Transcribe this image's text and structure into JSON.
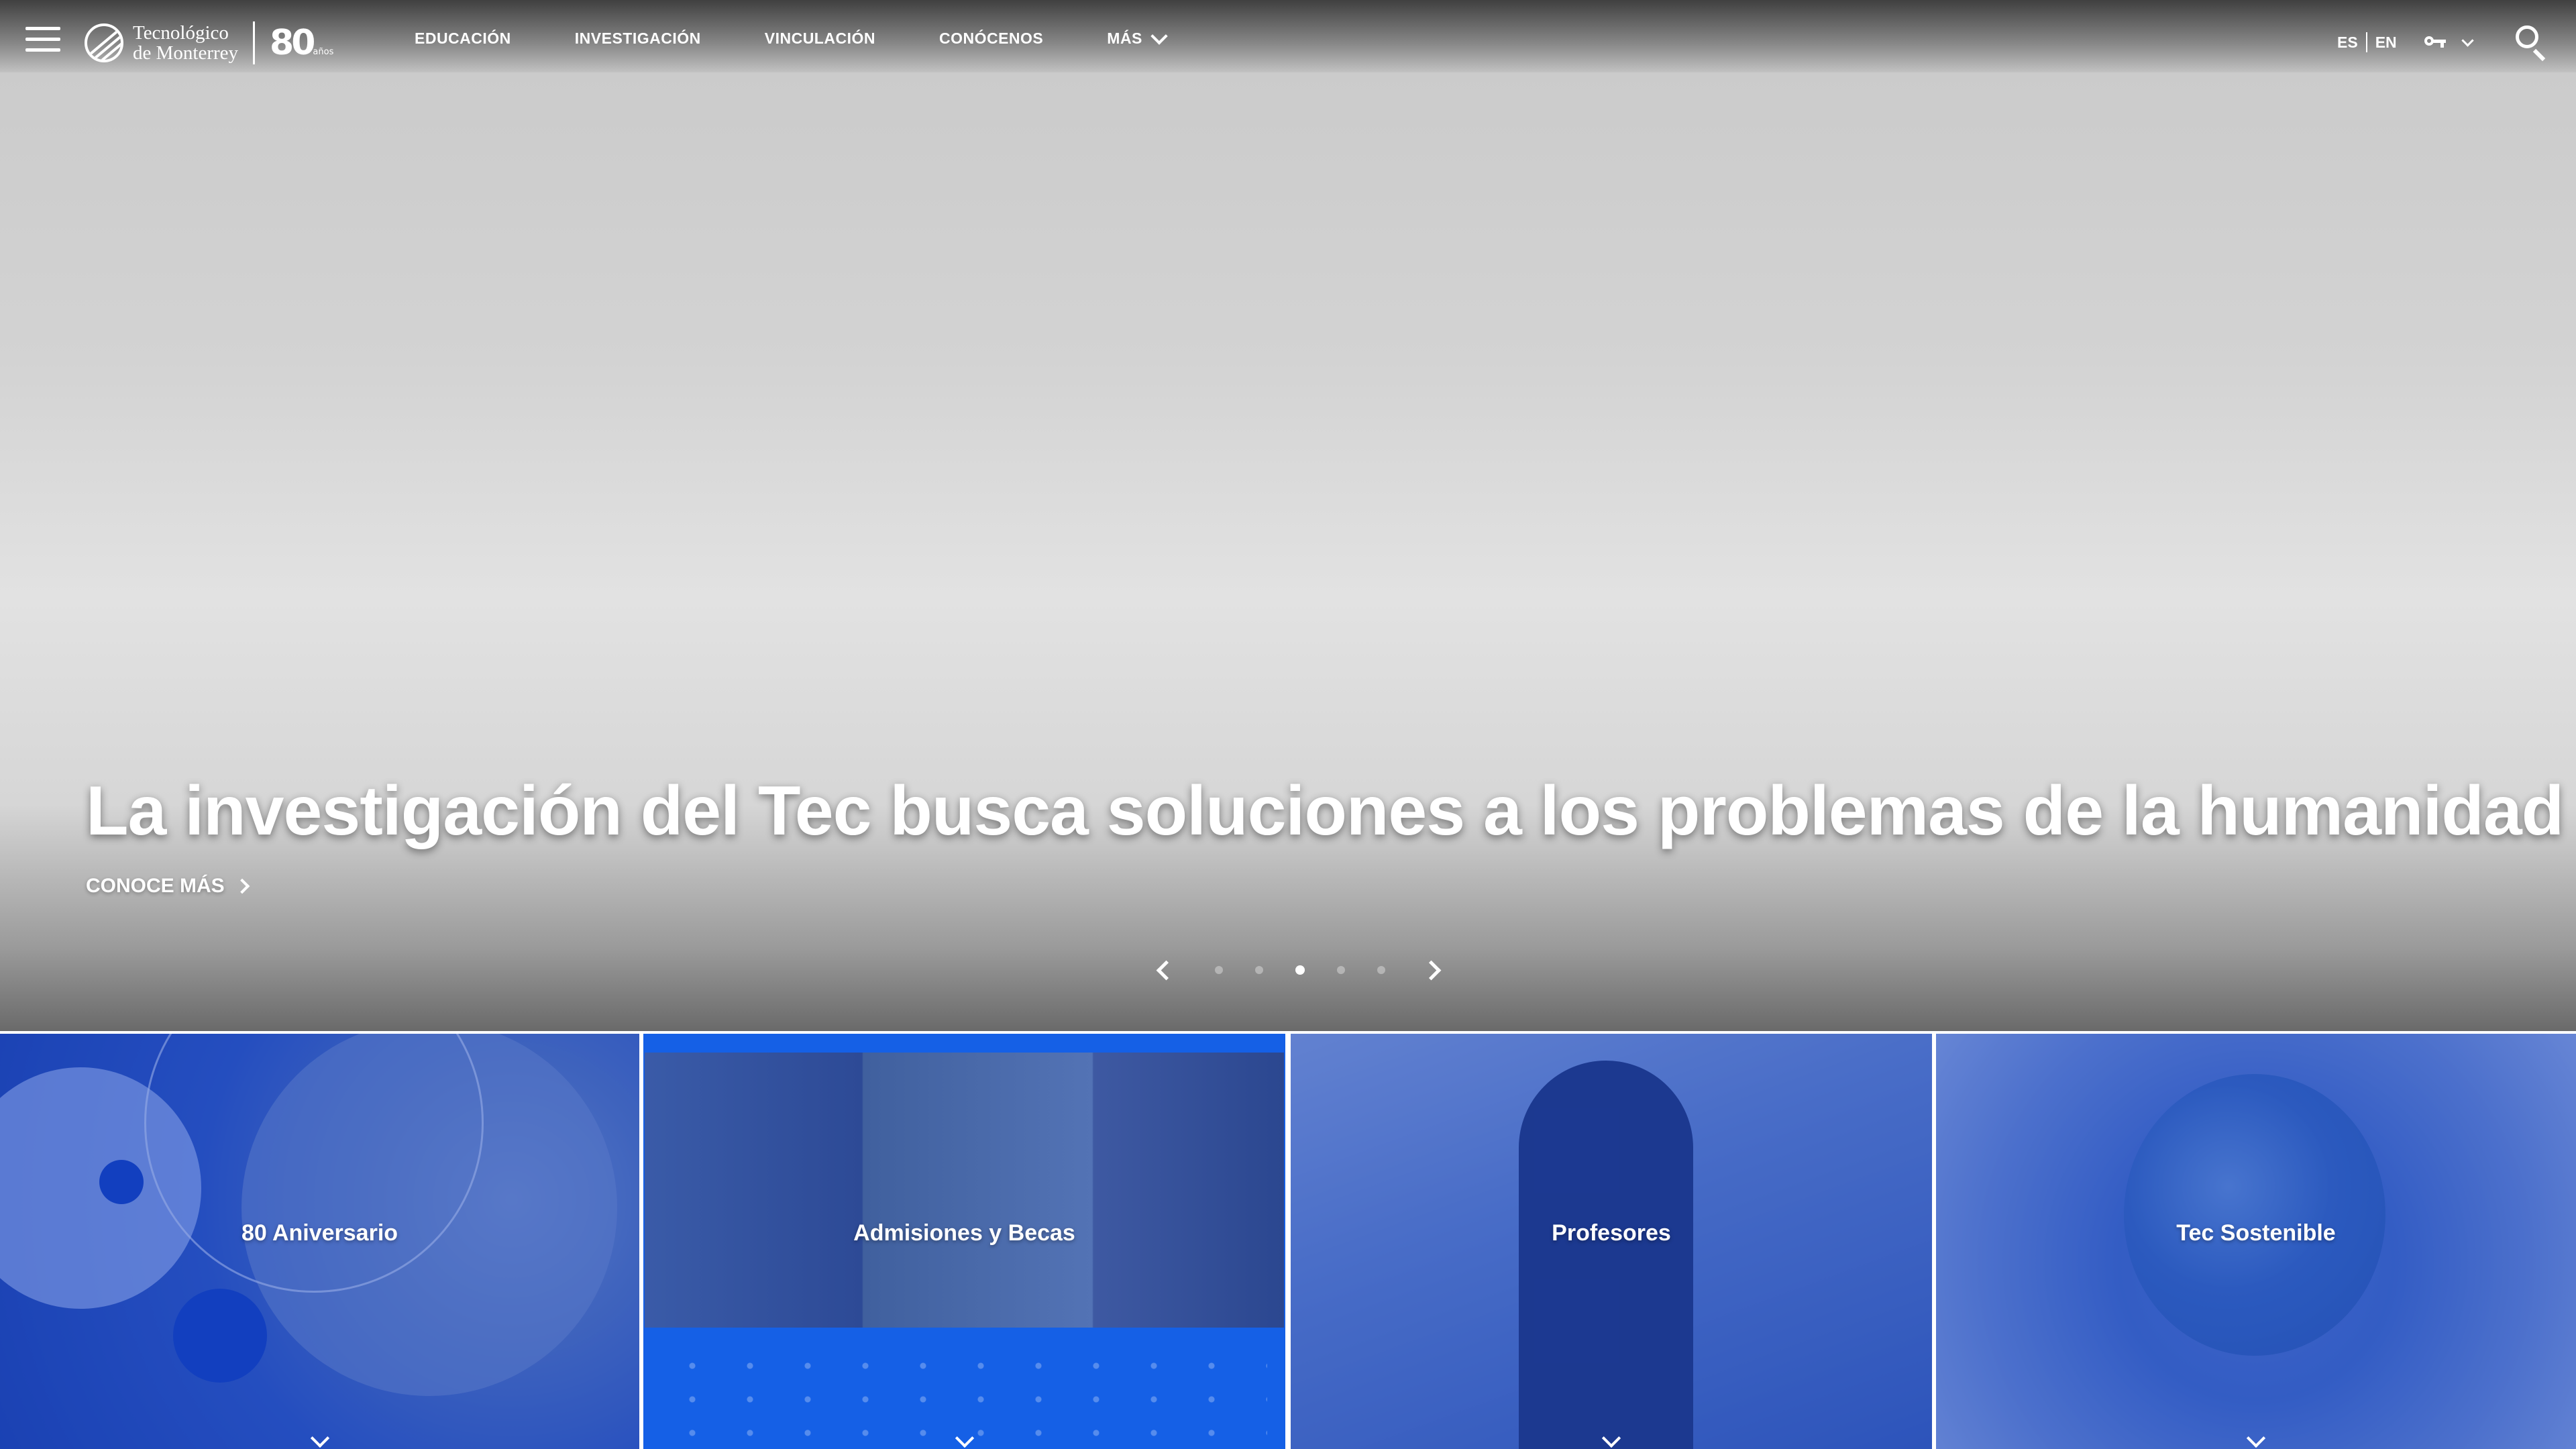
{
  "header": {
    "logo": {
      "line1": "Tecnológico",
      "line2": "de Monterrey",
      "anniversary": "80",
      "anniversary_suffix": "años"
    },
    "nav": [
      {
        "label": "EDUCACIÓN"
      },
      {
        "label": "INVESTIGACIÓN"
      },
      {
        "label": "VINCULACIÓN"
      },
      {
        "label": "CONÓCENOS"
      },
      {
        "label": "MÁS"
      }
    ],
    "lang": {
      "es": "ES",
      "en": "EN"
    },
    "icons": {
      "menu": "hamburger-menu-icon",
      "login": "key-icon",
      "search": "search-icon"
    }
  },
  "hero": {
    "headline": "La investigación del Tec busca soluciones a los problemas de la humanidad",
    "cta": "CONOCE MÁS",
    "carousel": {
      "total_slides": 5,
      "active_slide": 3
    }
  },
  "cards": [
    {
      "label": "80 Aniversario"
    },
    {
      "label": "Admisiones y Becas"
    },
    {
      "label": "Profesores"
    },
    {
      "label": "Tec Sostenible"
    }
  ],
  "colors": {
    "card_overlay": "#1946c8",
    "admisiones_blue": "#1560e6"
  }
}
